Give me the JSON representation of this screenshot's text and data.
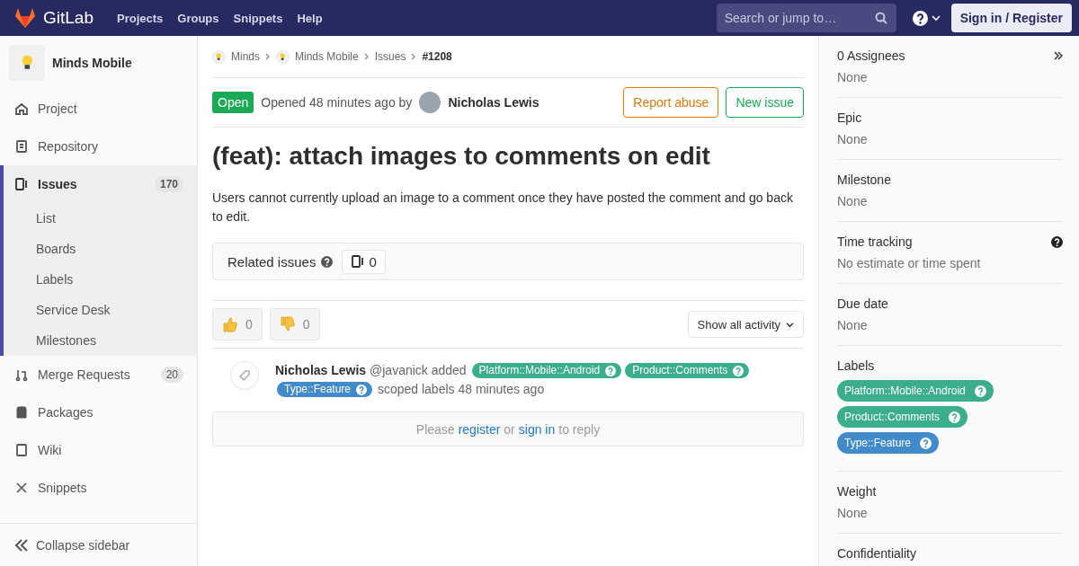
{
  "navbar": {
    "brand": "GitLab",
    "links": [
      "Projects",
      "Groups",
      "Snippets",
      "Help"
    ],
    "search": {
      "placeholder": "Search or jump to…"
    },
    "sign_in": "Sign in / Register"
  },
  "sidebar": {
    "project": "Minds Mobile",
    "items": [
      {
        "label": "Project",
        "selected": false
      },
      {
        "label": "Repository",
        "selected": false
      },
      {
        "label": "Issues",
        "count": "170",
        "selected": true,
        "children": [
          {
            "label": "List"
          },
          {
            "label": "Boards"
          },
          {
            "label": "Labels"
          },
          {
            "label": "Service Desk"
          },
          {
            "label": "Milestones"
          }
        ]
      },
      {
        "label": "Merge Requests",
        "count": "20",
        "selected": false
      },
      {
        "label": "Packages",
        "selected": false
      },
      {
        "label": "Wiki",
        "selected": false
      },
      {
        "label": "Snippets",
        "selected": false
      }
    ],
    "collapse": "Collapse sidebar"
  },
  "breadcrumbs": [
    {
      "label": "Minds",
      "avatar": true
    },
    {
      "label": "Minds Mobile",
      "avatar": true
    },
    {
      "label": "Issues",
      "avatar": false
    },
    {
      "label": "#1208",
      "avatar": false
    }
  ],
  "issue": {
    "status": "Open",
    "opened": "Opened 48 minutes ago by",
    "author": "Nicholas Lewis",
    "actions": [
      {
        "label": "Report abuse",
        "kind": "warning"
      },
      {
        "label": "New issue",
        "kind": "success"
      }
    ],
    "title": "(feat): attach images to comments on edit",
    "description": "Users cannot currently upload an image to a comment once they have posted the comment and go back to edit.",
    "related": {
      "label": "Related issues",
      "count": "0"
    },
    "reactions": [
      {
        "kind": "up",
        "count": "0"
      },
      {
        "kind": "down",
        "count": "0"
      }
    ],
    "activity_filter": "Show all activity",
    "event": {
      "author": "Nicholas Lewis",
      "handle": "@javanick added",
      "suffix": "scoped labels 48 minutes ago",
      "labels": [
        {
          "text": "Platform::Mobile::Android",
          "color": "#3cae8c"
        },
        {
          "text": "Product::Comments",
          "color": "#3cae8c"
        },
        {
          "text": "Type::Feature",
          "color": "#428bca"
        }
      ]
    },
    "reply": {
      "before": "Please",
      "register": "register",
      "middle": "or",
      "sign_in": "sign in",
      "after": "to reply"
    }
  },
  "right_sidebar": {
    "sections": [
      {
        "kind": "value",
        "title": "0 Assignees",
        "value": "None",
        "collapse": true
      },
      {
        "kind": "value",
        "title": "Epic",
        "value": "None"
      },
      {
        "kind": "value",
        "title": "Milestone",
        "value": "None"
      },
      {
        "kind": "value",
        "title": "Time tracking",
        "value": "No estimate or time spent",
        "help": true
      },
      {
        "kind": "value",
        "title": "Due date",
        "value": "None"
      },
      {
        "kind": "labels",
        "title": "Labels",
        "labels": [
          {
            "text": "Platform::Mobile::Android",
            "color": "#3cae8c"
          },
          {
            "text": "Product::Comments",
            "color": "#3cae8c"
          },
          {
            "text": "Type::Feature",
            "color": "#428bca"
          }
        ]
      },
      {
        "kind": "value",
        "title": "Weight",
        "value": "None"
      },
      {
        "kind": "title",
        "title": "Confidentiality"
      }
    ]
  }
}
